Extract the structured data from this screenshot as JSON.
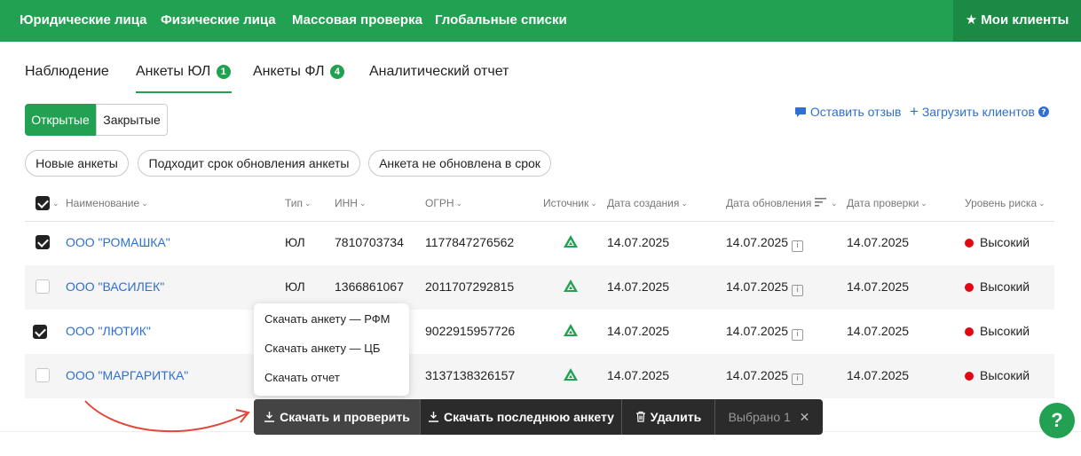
{
  "topnav": {
    "items": [
      "Юридические лица",
      "Физические лица",
      "Массовая проверка",
      "Глобальные списки"
    ],
    "my_clients": "Мои клиенты"
  },
  "tabs": [
    {
      "label": "Наблюдение",
      "badge": null
    },
    {
      "label": "Анкеты ЮЛ",
      "badge": "1",
      "active": true
    },
    {
      "label": "Анкеты ФЛ",
      "badge": "4"
    },
    {
      "label": "Аналитический отчет",
      "badge": null
    }
  ],
  "segment": {
    "open": "Открытые",
    "closed": "Закрытые"
  },
  "links": {
    "feedback": "Оставить отзыв",
    "upload": "Загрузить клиентов"
  },
  "filters": [
    "Новые анкеты",
    "Подходит срок обновления анкеты",
    "Анкета не обновлена в срок"
  ],
  "table": {
    "headers": {
      "name": "Наименование",
      "type": "Тип",
      "inn": "ИНН",
      "ogrn": "ОГРН",
      "source": "Источник",
      "created": "Дата создания",
      "updated": "Дата обновления",
      "checked": "Дата проверки",
      "risk": "Уровень риска"
    },
    "rows": [
      {
        "checked": true,
        "name": "ООО \"РОМАШКА\"",
        "type": "ЮЛ",
        "inn": "7810703734",
        "ogrn": "1177847276562",
        "created": "14.07.2025",
        "updated": "14.07.2025",
        "checked_date": "14.07.2025",
        "risk": "Высокий"
      },
      {
        "checked": false,
        "name": "ООО \"ВАСИЛЕК\"",
        "type": "ЮЛ",
        "inn": "1366861067",
        "ogrn": "2011707292815",
        "created": "14.07.2025",
        "updated": "14.07.2025",
        "checked_date": "14.07.2025",
        "risk": "Высокий"
      },
      {
        "checked": true,
        "name": "ООО \"ЛЮТИК\"",
        "type": "",
        "inn": "",
        "ogrn": "9022915957726",
        "created": "14.07.2025",
        "updated": "14.07.2025",
        "checked_date": "14.07.2025",
        "risk": "Высокий"
      },
      {
        "checked": false,
        "name": "ООО \"МАРГАРИТКА\"",
        "type": "",
        "inn": "",
        "ogrn": "3137138326157",
        "created": "14.07.2025",
        "updated": "14.07.2025",
        "checked_date": "14.07.2025",
        "risk": "Высокий"
      }
    ]
  },
  "menu": [
    "Скачать анкету — РФМ",
    "Скачать анкету — ЦБ",
    "Скачать отчет"
  ],
  "actions": {
    "download_check": "Скачать и проверить",
    "download_last": "Скачать последнюю анкету",
    "delete": "Удалить",
    "selected": "Выбрано 1"
  },
  "help": "?",
  "colors": {
    "brand": "#21a151",
    "link": "#2f6fcf",
    "risk_high": "#e30613",
    "actionbar": "#2b2b2b"
  }
}
